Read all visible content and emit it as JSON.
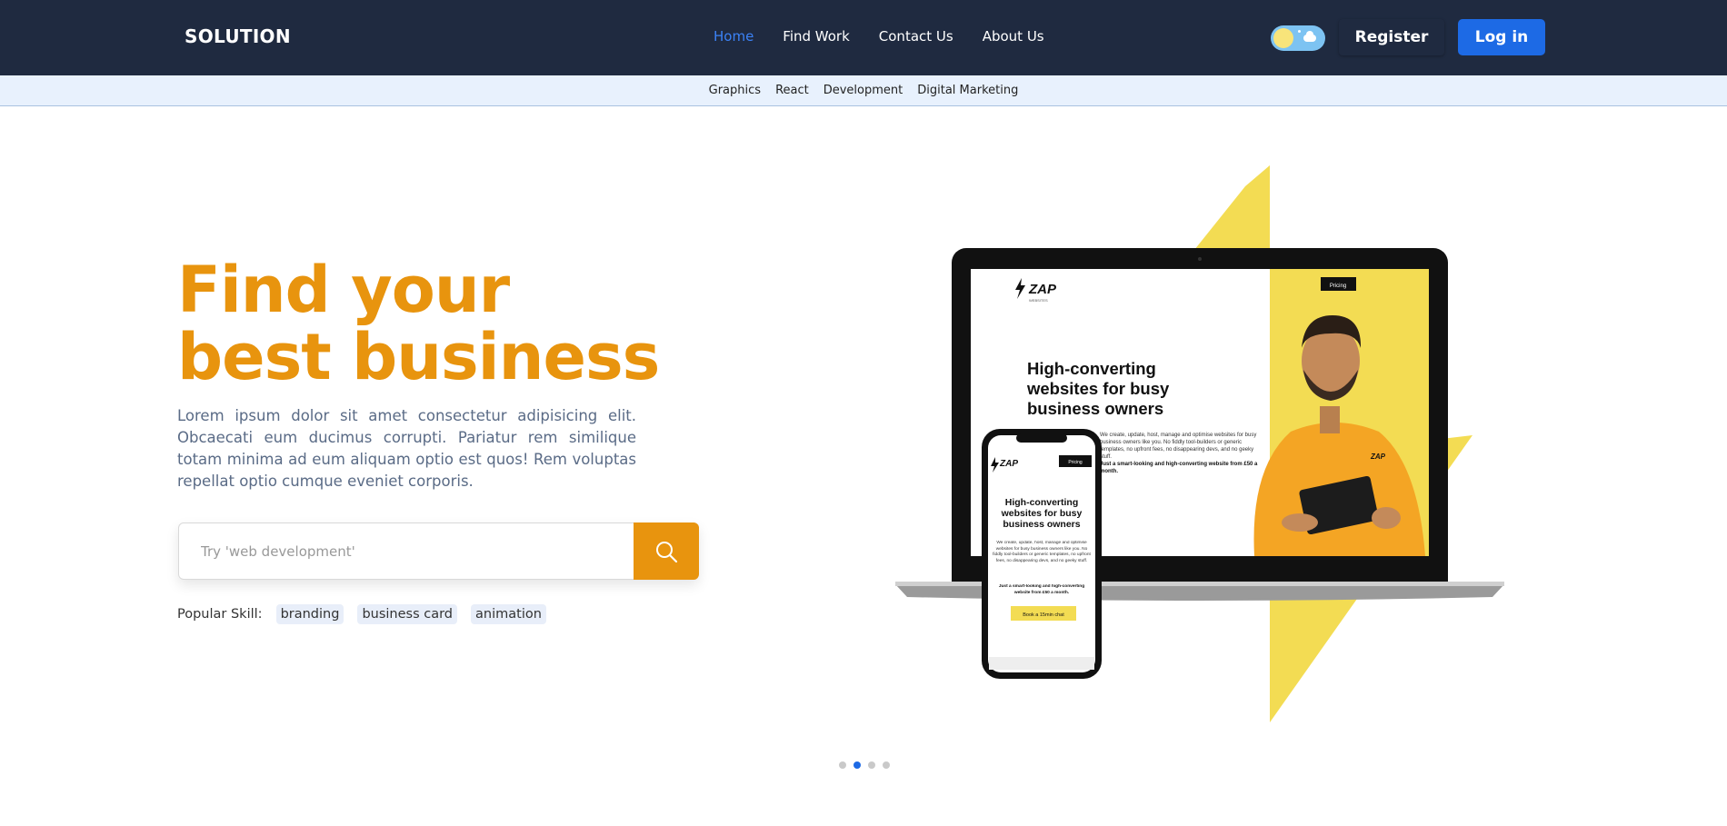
{
  "navbar": {
    "brand": "SOLUTION",
    "links": [
      {
        "label": "Home",
        "active": true
      },
      {
        "label": "Find Work",
        "active": false
      },
      {
        "label": "Contact Us",
        "active": false
      },
      {
        "label": "About Us",
        "active": false
      }
    ],
    "register_label": "Register",
    "login_label": "Log in"
  },
  "subnav": {
    "items": [
      "Graphics",
      "React",
      "Development",
      "Digital Marketing"
    ]
  },
  "hero": {
    "headline": "Find your best business",
    "description": "Lorem ipsum dolor sit amet consectetur adipisicing elit. Obcaecati eum ducimus corrupti. Pariatur rem similique totam minima ad eum aliquam optio est quos! Rem voluptas repellat optio cumque eveniet corporis.",
    "search": {
      "placeholder": "Try 'web development'",
      "value": ""
    },
    "popular": {
      "label": "Popular Skill:",
      "tags": [
        "branding",
        "business card",
        "animation"
      ]
    }
  },
  "mockup": {
    "logo": "ZAP",
    "logo_sub": "WEBSITES",
    "pricing_label": "Pricing",
    "heading": "High-converting websites for busy business owners",
    "body": "We create, update, host, manage and optimise websites for busy business owners like you. No fiddly tool-builders or generic templates, no upfront fees, no disappearing devs, and no geeky stuff.",
    "offer": "Just a smart-looking and high-converting website from £50 a month.",
    "cta": "Book a 15min chat"
  },
  "carousel": {
    "count": 4,
    "active_index": 1
  },
  "colors": {
    "navbar_bg": "#1f2a40",
    "accent_orange": "#e8940e",
    "accent_blue": "#1d6ae5",
    "bolt_yellow": "#f3dc53"
  }
}
